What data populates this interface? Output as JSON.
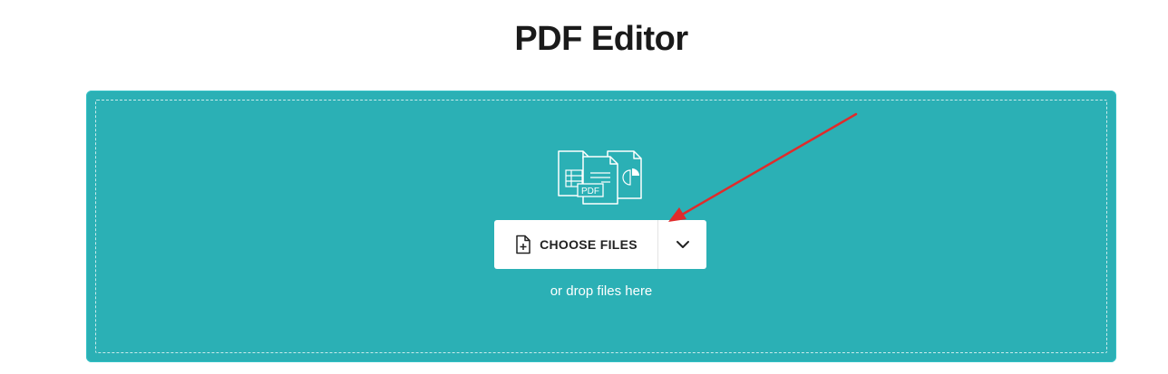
{
  "page": {
    "title": "PDF Editor"
  },
  "dropzone": {
    "illustration_icon": "file-types-icon",
    "choose_files_label": "CHOOSE FILES",
    "choose_files_icon": "add-file-icon",
    "dropdown_icon": "chevron-down-icon",
    "drop_hint": "or drop files here",
    "pdf_badge": "PDF"
  },
  "colors": {
    "accent": "#2bb0b5",
    "annotation": "#e02b2b"
  }
}
